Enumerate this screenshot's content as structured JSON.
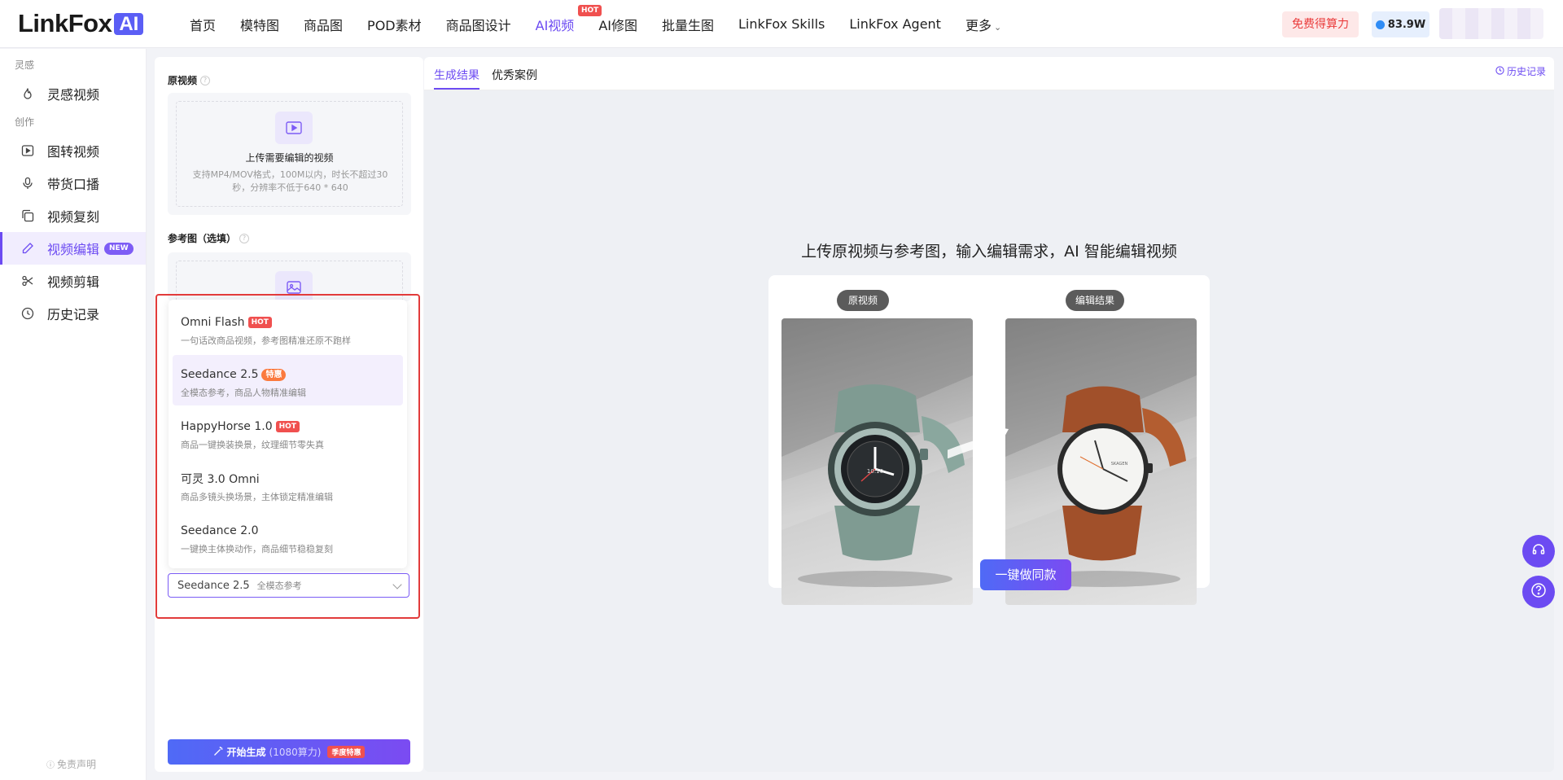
{
  "brand": {
    "logo_text": "LinkFox",
    "logo_ai": "AI"
  },
  "nav": {
    "items": [
      {
        "label": "首页"
      },
      {
        "label": "模特图"
      },
      {
        "label": "商品图"
      },
      {
        "label": "POD素材"
      },
      {
        "label": "商品图设计"
      },
      {
        "label": "AI视频",
        "badge": "HOT"
      },
      {
        "label": "AI修图"
      },
      {
        "label": "批量生图"
      },
      {
        "label": "LinkFox Skills"
      },
      {
        "label": "LinkFox Agent"
      },
      {
        "label": "更多"
      }
    ],
    "free_credits_label": "免费得算力",
    "credits_value": "83.9W"
  },
  "sidebar": {
    "section_inspiration": "灵感",
    "section_create": "创作",
    "items": [
      {
        "label": "灵感视频",
        "icon": "flame-icon"
      },
      {
        "label": "图转视频",
        "icon": "play-square-icon"
      },
      {
        "label": "带货口播",
        "icon": "microphone-icon"
      },
      {
        "label": "视频复刻",
        "icon": "copy-icon"
      },
      {
        "label": "视频编辑",
        "icon": "pencil-icon",
        "badge": "NEW"
      },
      {
        "label": "视频剪辑",
        "icon": "scissors-icon"
      },
      {
        "label": "历史记录",
        "icon": "clock-icon"
      }
    ],
    "disclaimer": "免责声明"
  },
  "editor": {
    "source_video_label": "原视频",
    "upload_title": "上传需要编辑的视频",
    "upload_desc": "支持MP4/MOV格式，100M以内，时长不超过30秒，分辨率不低于640 * 640",
    "reference_label": "参考图（选填）",
    "model_options": [
      {
        "name": "Omni Flash",
        "badge": "HOT",
        "desc": "一句话改商品视频，参考图精准还原不跑样"
      },
      {
        "name": "Seedance 2.5",
        "badge": "特惠",
        "desc": "全模态参考，商品人物精准编辑"
      },
      {
        "name": "HappyHorse 1.0",
        "badge": "HOT",
        "desc": "商品一键换装换景，纹理细节零失真"
      },
      {
        "name": "可灵 3.0 Omni",
        "badge": "",
        "desc": "商品多镜头换场景，主体锁定精准编辑"
      },
      {
        "name": "Seedance 2.0",
        "badge": "",
        "desc": "一键换主体换动作，商品细节稳稳复刻"
      }
    ],
    "selected_model": {
      "name": "Seedance 2.5",
      "desc": "全模态参考"
    },
    "generate": {
      "label": "开始生成",
      "cost": "(1080算力)",
      "badge": "季度特惠"
    }
  },
  "result": {
    "tabs": [
      {
        "label": "生成结果"
      },
      {
        "label": "优秀案例"
      }
    ],
    "history_label": "历史记录",
    "headline": "上传原视频与参考图，输入编辑需求，AI 智能编辑视频",
    "before_label": "原视频",
    "after_label": "编辑结果",
    "watch_dial_text": "10:10",
    "watch_brand_text": "SKAGEN",
    "same_style_button": "一键做同款"
  },
  "colors": {
    "accent": "#6c4bf2",
    "hot_badge": "#f0504f",
    "highlight_border": "#e23b3b"
  }
}
